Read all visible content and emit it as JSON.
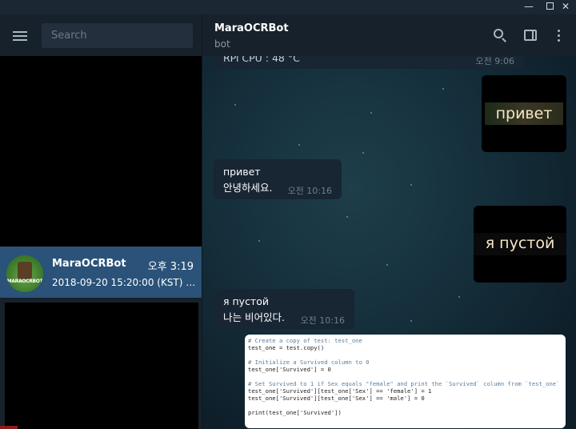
{
  "search": {
    "placeholder": "Search"
  },
  "chat_list": {
    "active": {
      "name": "MaraOCRBot",
      "time": "오후 3:19",
      "preview": "2018-09-20 15:20:00 (KST)  15:...",
      "avatar_text": "MARAOCRBOT"
    }
  },
  "header": {
    "name": "MaraOCRBot",
    "status": "bot"
  },
  "messages": {
    "top": {
      "text": "RPi CPU : 48 °C",
      "time": "오전 9:06"
    },
    "m1": {
      "line1": "привет",
      "line2": "안녕하세요.",
      "time": "오전 10:16"
    },
    "m2": {
      "line1": "я пустой",
      "line2": "나는 비어있다.",
      "time": "오전 10:16"
    },
    "photo1_text": "привет",
    "photo2_text": "я пустой"
  },
  "code_image": {
    "lines": [
      "# Create a copy of test: test_one",
      "test_one = test.copy()",
      "",
      "# Initialize a Survived column to 0",
      "test_one['Survived'] = 0",
      "",
      "# Set Survived to 1 if Sex equals \"female\" and print the `Survived` column from `test_one`",
      "test_one['Survived'][test_one['Sex'] == 'female'] = 1",
      "test_one['Survived'][test_one['Sex'] == 'male'] = 0",
      "",
      "print(test_one['Survived'])"
    ]
  },
  "icons": {
    "menu": "hamburger-icon",
    "search": "search-icon",
    "panel": "sidebar-toggle-icon",
    "more": "more-vertical-icon"
  },
  "colors": {
    "active_chat": "#2b5278",
    "bubble": "#182533",
    "panel": "#17212b"
  }
}
